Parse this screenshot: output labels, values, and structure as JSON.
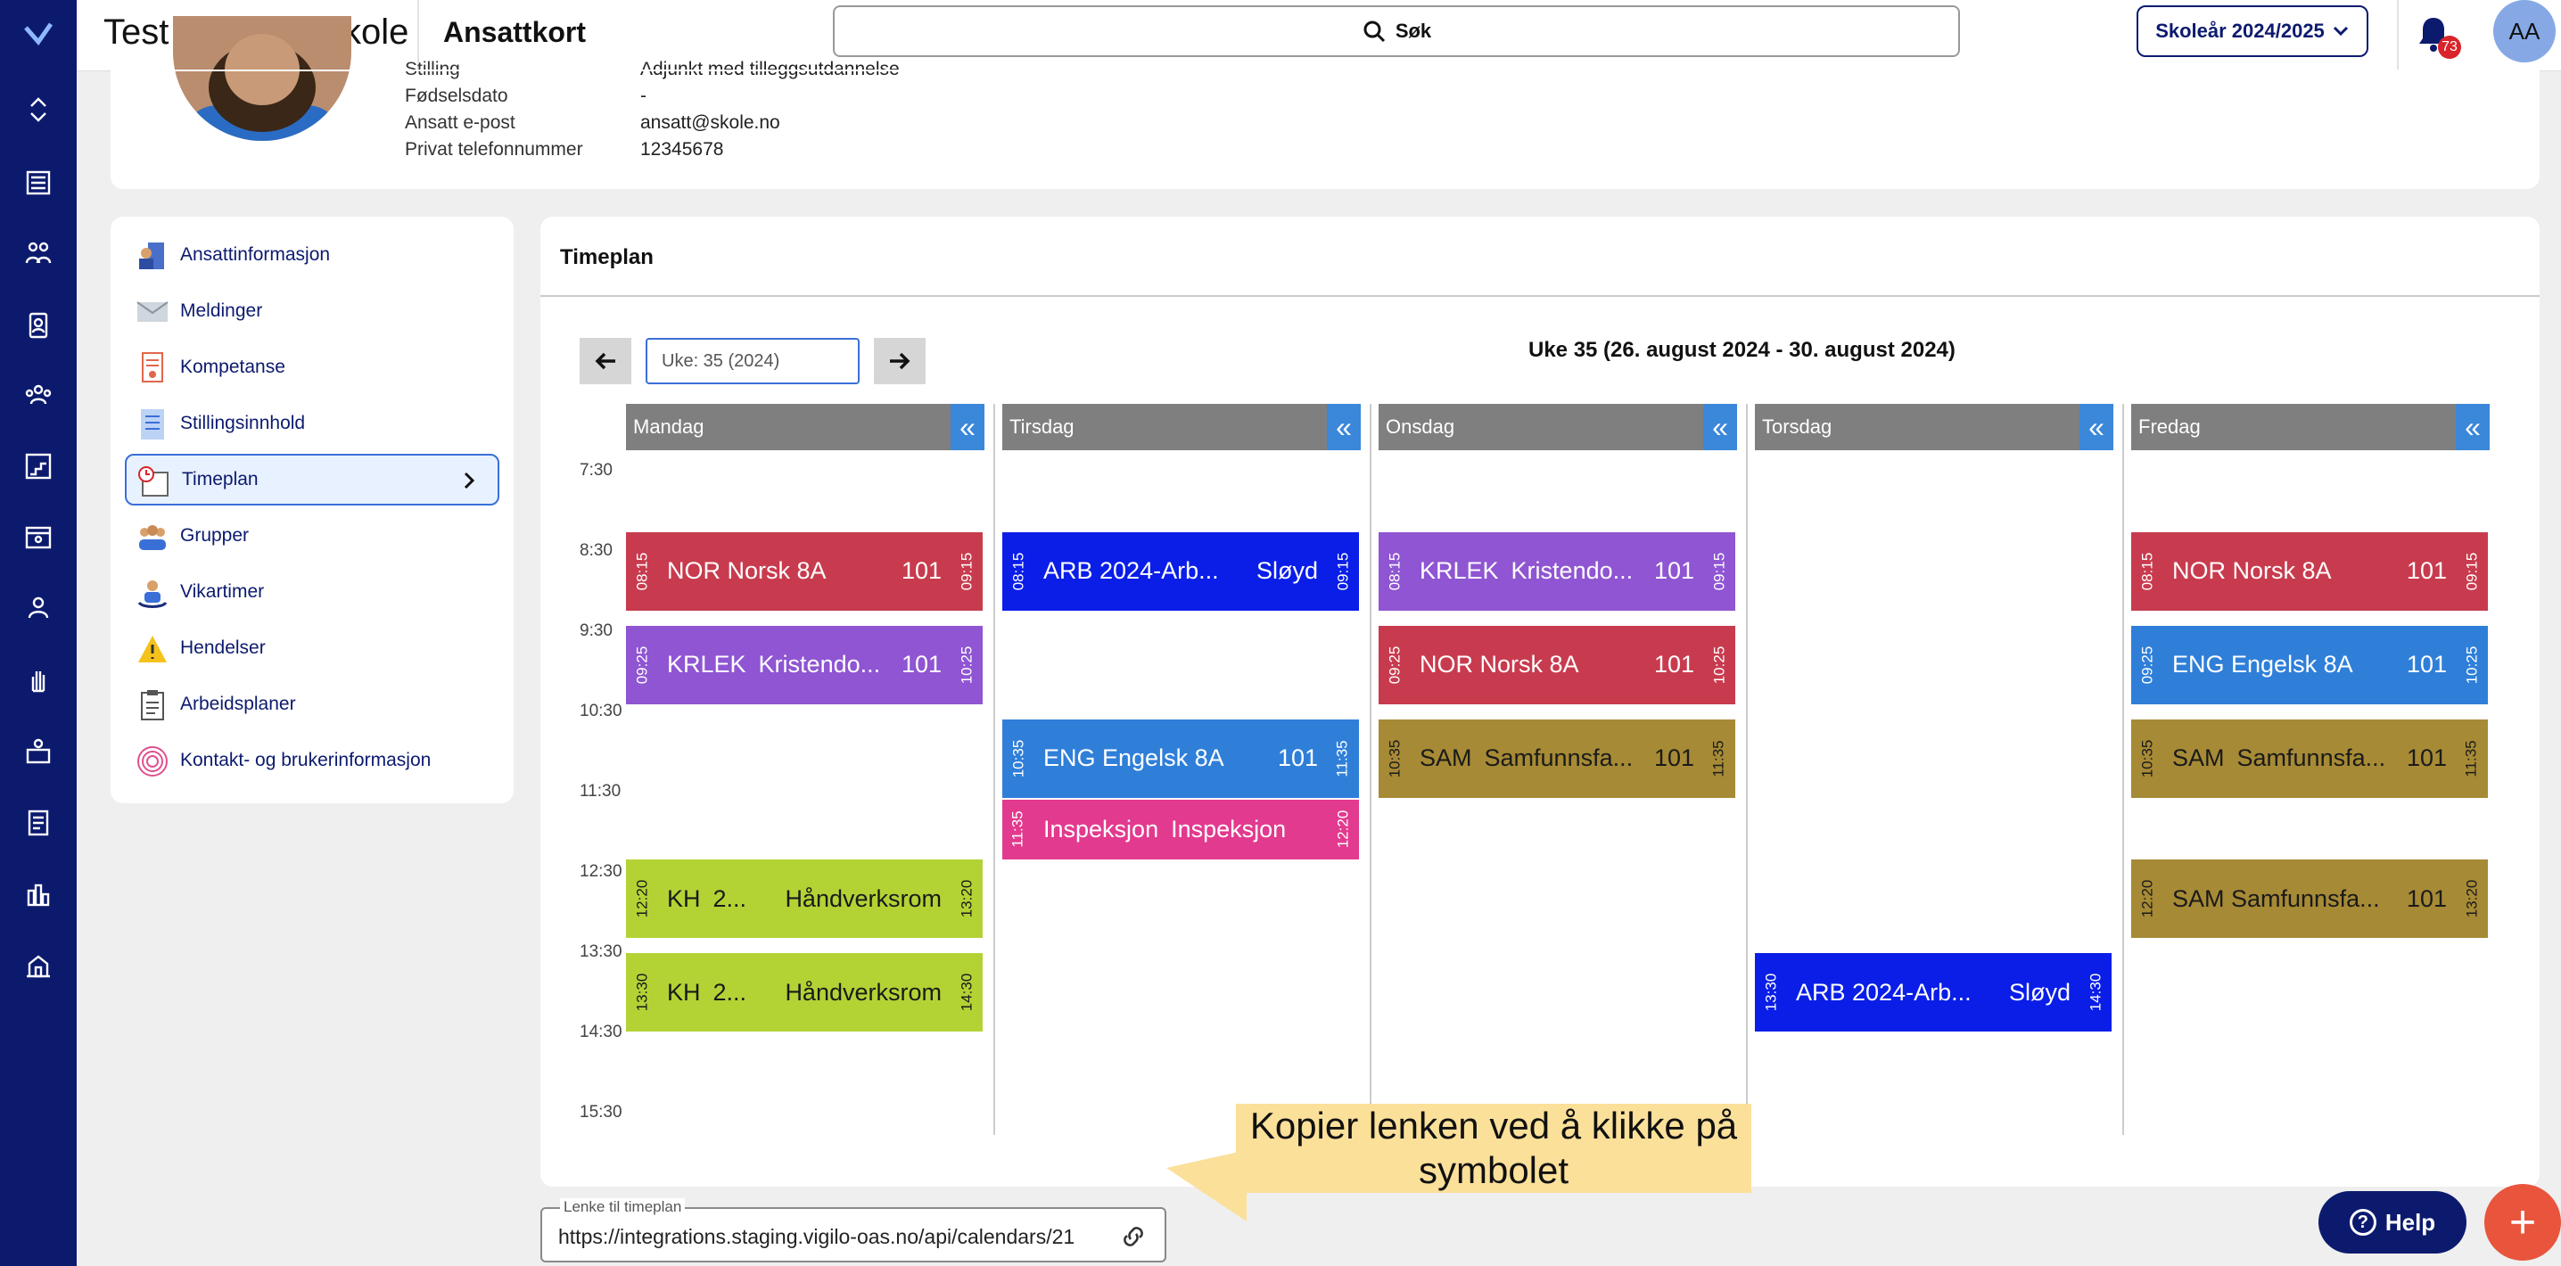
{
  "app": {
    "school": "Test ungdomsskole",
    "page_title": "Ansattkort"
  },
  "search": {
    "label": "Søk"
  },
  "year_select": {
    "label": "Skoleår 2024/2025"
  },
  "notifications": {
    "count": "73"
  },
  "user": {
    "initials": "AA"
  },
  "profile": {
    "rows": [
      {
        "label": "Stilling",
        "value": "Adjunkt med tilleggsutdannelse"
      },
      {
        "label": "Fødselsdato",
        "value": "-"
      },
      {
        "label": "Ansatt e-post",
        "value": "ansatt@skole.no"
      },
      {
        "label": "Privat telefonnummer",
        "value": "12345678"
      }
    ]
  },
  "menu": {
    "items": [
      {
        "label": "Ansattinformasjon"
      },
      {
        "label": "Meldinger"
      },
      {
        "label": "Kompetanse"
      },
      {
        "label": "Stillingsinnhold"
      },
      {
        "label": "Timeplan"
      },
      {
        "label": "Grupper"
      },
      {
        "label": "Vikartimer"
      },
      {
        "label": "Hendelser"
      },
      {
        "label": "Arbeidsplaner"
      },
      {
        "label": "Kontakt- og brukerinformasjon"
      }
    ]
  },
  "timeplan": {
    "title": "Timeplan",
    "week_input": "Uke: 35 (2024)",
    "week_title": "Uke 35 (26. august 2024 - 30. august 2024)",
    "collapse_glyph": "«",
    "days": [
      "Mandag",
      "Tirsdag",
      "Onsdag",
      "Torsdag",
      "Fredag"
    ],
    "times": [
      "7:30",
      "8:30",
      "9:30",
      "10:30",
      "11:30",
      "12:30",
      "13:30",
      "14:30",
      "15:30"
    ],
    "colors": {
      "red": "#c83b4e",
      "blue": "#0a1ee8",
      "purple": "#8f55d2",
      "pink": "#e23a8e",
      "lightblue": "#2f7fd9",
      "brown": "#a68a35",
      "lime": "#b3d335"
    },
    "events": [
      {
        "day": 0,
        "start": "08:15",
        "end": "09:15",
        "a": "NOR Norsk 8A",
        "b": "",
        "r": "101",
        "color": "red"
      },
      {
        "day": 0,
        "start": "09:25",
        "end": "10:25",
        "a": "KRLEK",
        "b": "Kristendo...",
        "r": "101",
        "color": "purple"
      },
      {
        "day": 0,
        "start": "12:20",
        "end": "13:20",
        "a": "KH",
        "b": "2...",
        "r": "Håndverksrom",
        "color": "lime"
      },
      {
        "day": 0,
        "start": "13:30",
        "end": "14:30",
        "a": "KH",
        "b": "2...",
        "r": "Håndverksrom",
        "color": "lime"
      },
      {
        "day": 1,
        "start": "08:15",
        "end": "09:15",
        "a": "ARB 2024-Arb...",
        "b": "",
        "r": "Sløyd",
        "color": "blue"
      },
      {
        "day": 1,
        "start": "10:35",
        "end": "11:35",
        "a": "ENG Engelsk 8A",
        "b": "",
        "r": "101",
        "color": "lightblue"
      },
      {
        "day": 1,
        "start": "11:35",
        "end": "12:20",
        "a": "Inspeksjon",
        "b": "Inspeksjon",
        "r": "",
        "color": "pink"
      },
      {
        "day": 2,
        "start": "08:15",
        "end": "09:15",
        "a": "KRLEK",
        "b": "Kristendo...",
        "r": "101",
        "color": "purple"
      },
      {
        "day": 2,
        "start": "09:25",
        "end": "10:25",
        "a": "NOR Norsk 8A",
        "b": "",
        "r": "101",
        "color": "red"
      },
      {
        "day": 2,
        "start": "10:35",
        "end": "11:35",
        "a": "SAM",
        "b": "Samfunnsfa...",
        "r": "101",
        "color": "brown"
      },
      {
        "day": 3,
        "start": "13:30",
        "end": "14:30",
        "a": "ARB 2024-Arb...",
        "b": "",
        "r": "Sløyd",
        "color": "blue"
      },
      {
        "day": 4,
        "start": "08:15",
        "end": "09:15",
        "a": "NOR Norsk 8A",
        "b": "",
        "r": "101",
        "color": "red"
      },
      {
        "day": 4,
        "start": "09:25",
        "end": "10:25",
        "a": "ENG Engelsk 8A",
        "b": "",
        "r": "101",
        "color": "lightblue"
      },
      {
        "day": 4,
        "start": "10:35",
        "end": "11:35",
        "a": "SAM",
        "b": "Samfunnsfa...",
        "r": "101",
        "color": "brown"
      },
      {
        "day": 4,
        "start": "12:20",
        "end": "13:20",
        "a": "SAM Samfunnsfa...",
        "b": "",
        "r": "101",
        "color": "brown"
      }
    ]
  },
  "callout": {
    "text": "Kopier lenken ved å klikke på symbolet"
  },
  "link": {
    "label": "Lenke til timeplan",
    "value": "https://integrations.staging.vigilo-oas.no/api/calendars/21"
  },
  "help": {
    "label": "Help"
  },
  "fab": {
    "label": "+"
  }
}
